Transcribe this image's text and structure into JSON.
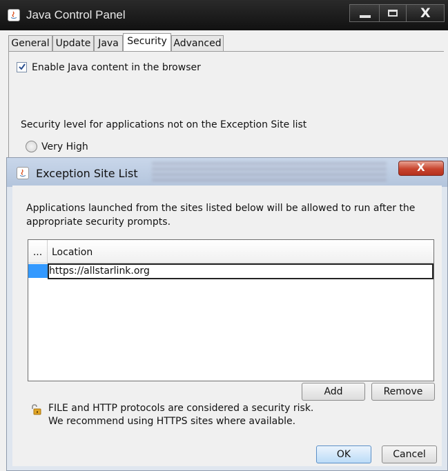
{
  "main_window": {
    "title": "Java Control Panel",
    "tabs": [
      "General",
      "Update",
      "Java",
      "Security",
      "Advanced"
    ],
    "active_tab": "Security",
    "enable_java_label": "Enable Java content in the browser",
    "enable_java_checked": true,
    "security_level_label": "Security level for applications not on the Exception Site list",
    "level_option": "Very High"
  },
  "dialog": {
    "title": "Exception Site List",
    "description": "Applications launched from the sites listed below will be allowed to run after the appropriate security prompts.",
    "table": {
      "columns": [
        "...",
        "Location"
      ],
      "rows": [
        {
          "location": "https://allstarlink.org"
        }
      ]
    },
    "add_label": "Add",
    "remove_label": "Remove",
    "warning_line1": "FILE and HTTP protocols are considered a security risk.",
    "warning_line2": "We recommend using HTTPS sites where available.",
    "ok_label": "OK",
    "cancel_label": "Cancel"
  },
  "colors": {
    "selection": "#3399ff",
    "dialog_close": "#c8442e",
    "titlebar_dark": "#1c1c1c"
  }
}
